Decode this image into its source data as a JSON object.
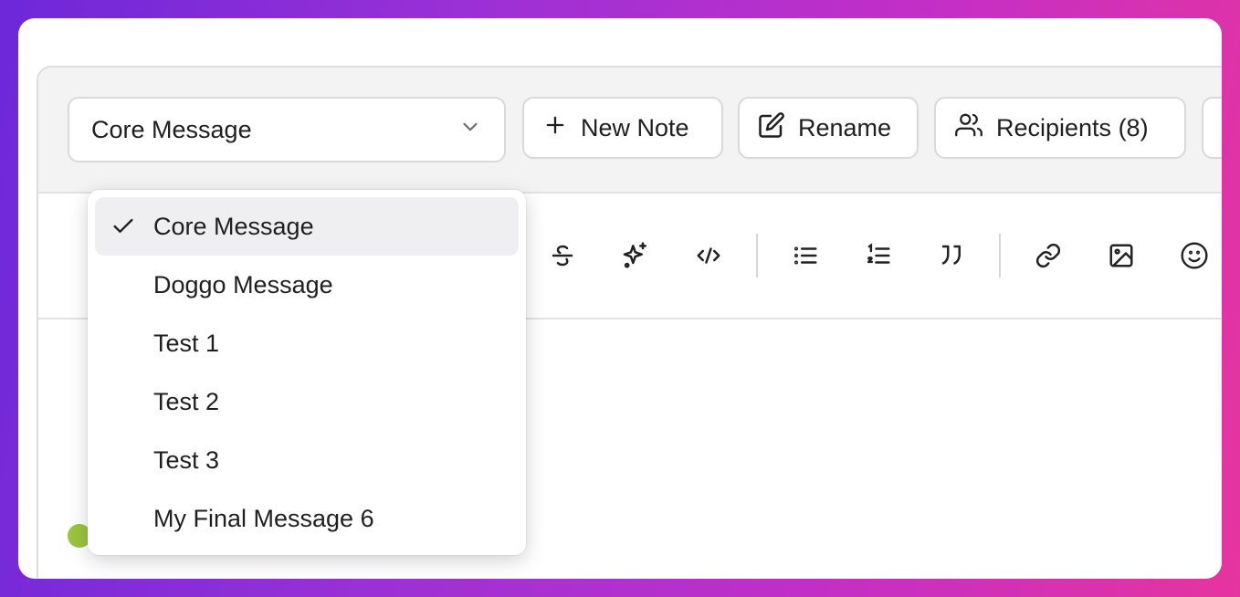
{
  "toolbar": {
    "note_select": {
      "value": "Core Message"
    },
    "new_note_label": "New Note",
    "rename_label": "Rename",
    "recipients_label": "Recipients (8)"
  },
  "editor_tools": [
    "strikethrough-icon",
    "sparkles-icon",
    "code-icon",
    "bullet-list-icon",
    "numbered-list-icon",
    "quote-icon",
    "link-icon",
    "image-icon",
    "emoji-icon"
  ],
  "dropdown": {
    "options": [
      {
        "label": "Core Message",
        "selected": true
      },
      {
        "label": "Doggo Message",
        "selected": false
      },
      {
        "label": "Test 1",
        "selected": false
      },
      {
        "label": "Test 2",
        "selected": false
      },
      {
        "label": "Test 3",
        "selected": false
      },
      {
        "label": "My Final Message 6",
        "selected": false
      }
    ]
  },
  "colors": {
    "background_gradient_start": "#6d28d9",
    "background_gradient_end": "#e6349f",
    "selected_option_bg": "#efeff1",
    "topbar_bg": "#f3f3f3"
  }
}
